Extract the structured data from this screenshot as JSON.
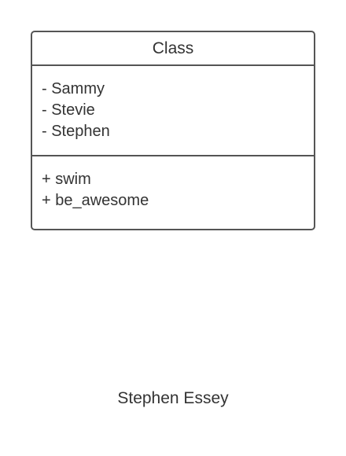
{
  "class_box": {
    "name": "Class",
    "attributes": [
      "- Sammy",
      "- Stevie",
      "- Stephen"
    ],
    "methods": [
      "+ swim",
      "+ be_awesome"
    ]
  },
  "author": "Stephen Essey",
  "colors": {
    "border": "#555555",
    "text": "#333333",
    "background": "#ffffff"
  }
}
